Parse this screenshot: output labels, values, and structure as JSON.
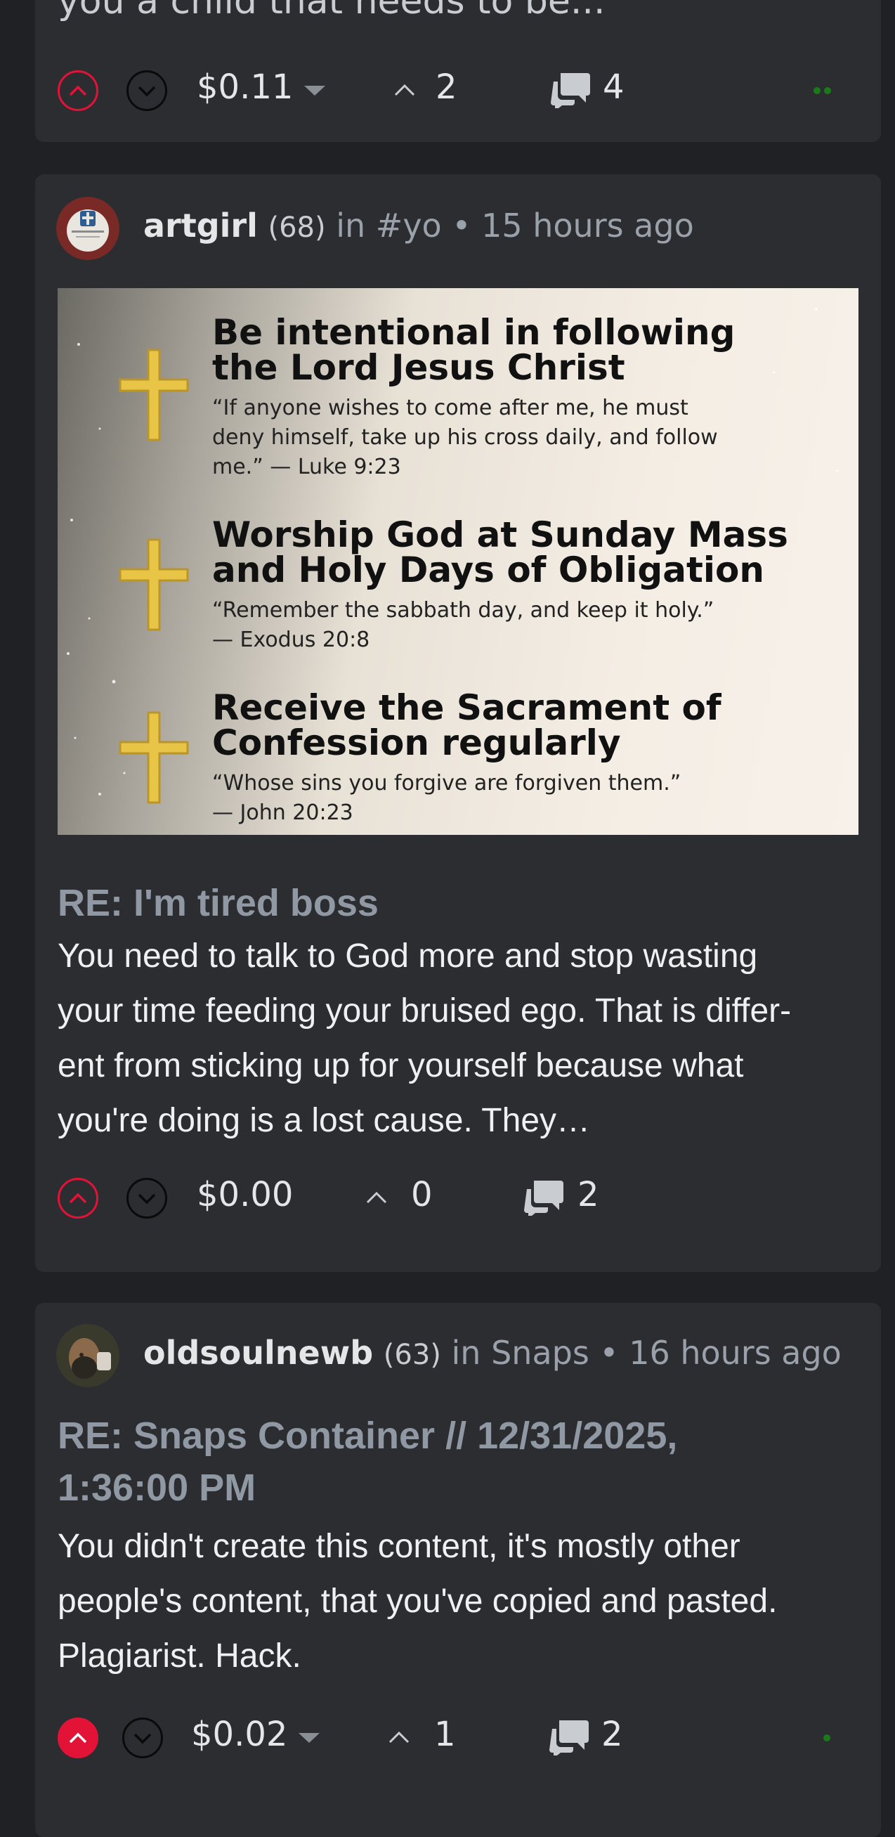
{
  "top_post": {
    "snippet": "you a child that needs to be...",
    "payout": "$0.11",
    "votes": "2",
    "comments": "4"
  },
  "posts": [
    {
      "author": "artgirl",
      "reputation": "(68)",
      "community": "in #yo",
      "separator": "•",
      "time": "15 hours ago",
      "image": {
        "items": [
          {
            "heading_line1": "Be intentional in following",
            "heading_line2": "the Lord Jesus Christ",
            "quote_line1": "“If anyone wishes to come after me, he must",
            "quote_line2": "deny himself, take up his cross daily, and follow",
            "quote_line3": "me.” — Luke 9:23"
          },
          {
            "heading_line1": "Worship God at Sunday Mass",
            "heading_line2": "and Holy Days of Obligation",
            "quote_line1": "“Remember the sabbath day, and keep it holy.”",
            "quote_line2": " — Exodus 20:8"
          },
          {
            "heading_line1": "Receive the Sacrament of",
            "heading_line2": "Confession regularly",
            "quote_line1": "“Whose sins you forgive are forgiven them.”",
            "quote_line2": " — John 20:23"
          }
        ]
      },
      "title": "RE: I'm tired boss",
      "body_line1": "You need to talk to God more and stop wasting",
      "body_line2": "your time feeding your bruised ego. That is differ-",
      "body_line3": "ent from sticking up for yourself because what",
      "body_line4": "you're doing is a lost cause. They…",
      "payout": "$0.00",
      "votes": "0",
      "comments": "2"
    },
    {
      "author": "oldsoulnewb",
      "reputation": "(63)",
      "community": "in Snaps",
      "separator": "•",
      "time": "16 hours ago",
      "title_line1": "RE: Snaps Container // 12/31/2025,",
      "title_line2": "1:36:00 PM",
      "body_line1": "You didn't create this content, it's mostly other",
      "body_line2": "people's content, that you've copied and pasted.",
      "body_line3": "Plagiarist. Hack.",
      "payout": "$0.02",
      "votes": "1",
      "comments": "2"
    }
  ],
  "colors": {
    "background": "#1f2124",
    "card": "#2b2d31",
    "upvote": "#e31337",
    "online_dot": "#1a7a1a"
  }
}
